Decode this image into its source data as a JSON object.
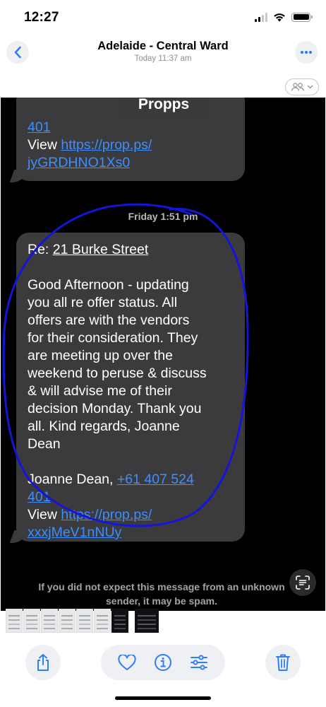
{
  "status_bar": {
    "time": "12:27"
  },
  "nav": {
    "title": "Adelaide - Central Ward",
    "subtitle": "Today  11:37 am"
  },
  "screenshot": {
    "sender": "Propps",
    "message1": {
      "line1": "401",
      "view_label": "View ",
      "link_part1": "https://prop.ps/",
      "link_part2": "jyGRDHNO1Xs0"
    },
    "day_stamp": "Friday 1:51 pm",
    "message2": {
      "re_label": "Re: ",
      "subject": "21 Burke  Street",
      "body_lines": [
        "Good Afternoon - updating",
        "you all re offer status. All",
        "offers are with the vendors",
        "for their consideration.  They",
        "are meeting up over the",
        "weekend to peruse & discuss",
        "& will advise me of their",
        "decision Monday. Thank you",
        "all. Kind regards, Joanne",
        "Dean"
      ],
      "signature_name": "Joanne Dean, ",
      "phone_part1": "+61 407 524",
      "phone_part2": "401",
      "view_label": "View ",
      "link_part1": "https://prop.ps/",
      "link_part2": "xxxjMeV1nNUy"
    },
    "spam_line1": "If you did not expect this message from an unknown",
    "spam_line2": "sender, it may be spam.",
    "annotation_color": "#1515d8"
  },
  "toolbar": {
    "share_icon": "share-icon",
    "favorite_icon": "heart-icon",
    "info_icon": "info-icon",
    "adjust_icon": "sliders-icon",
    "delete_icon": "trash-icon"
  },
  "colors": {
    "accent": "#2f7ff2",
    "link": "#3d8eff",
    "bubble": "#3b3b3d"
  }
}
